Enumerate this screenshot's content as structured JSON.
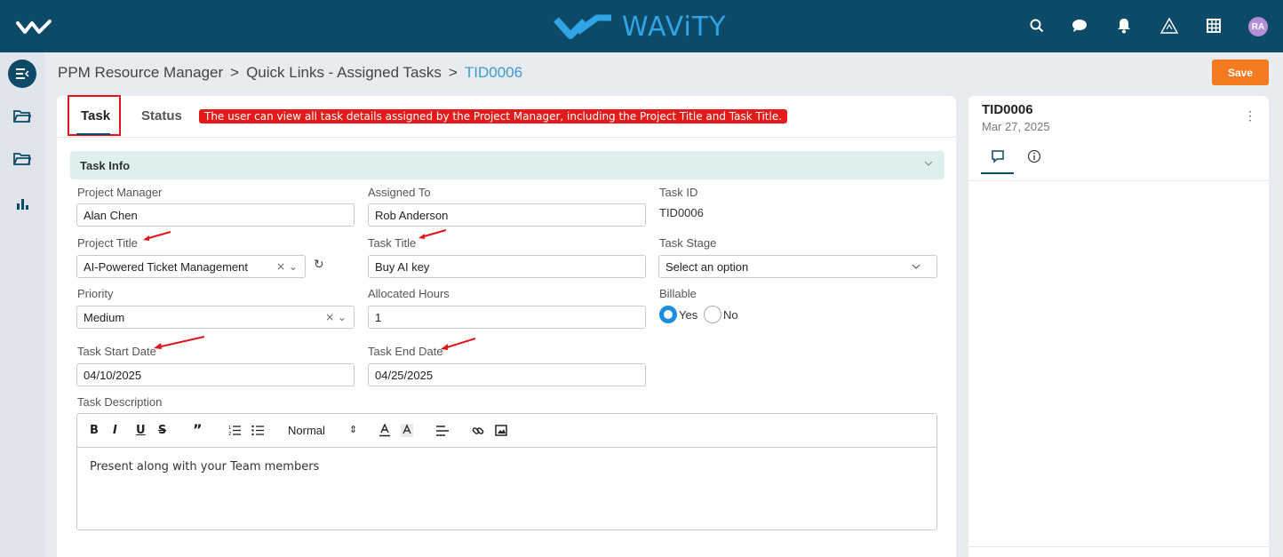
{
  "header": {
    "brand": "WAViTY",
    "avatar_initials": "RA",
    "icons": [
      "search-icon",
      "chat-icon",
      "bell-icon",
      "triangle-logo-icon",
      "grid-icon"
    ]
  },
  "sidebar": {
    "items": [
      "collapse-menu-icon",
      "folder-icon",
      "folder-icon",
      "bar-chart-icon"
    ]
  },
  "breadcrumb": {
    "item1": "PPM Resource Manager",
    "sep": ">",
    "item2": "Quick Links - Assigned Tasks",
    "current": "TID0006"
  },
  "toolbar": {
    "save_label": "Save"
  },
  "tabs": {
    "task": "Task",
    "status": "Status"
  },
  "annotation": "The user can view all task details assigned by the Project Manager, including the Project Title and Task Title.",
  "section": {
    "title": "Task Info"
  },
  "form": {
    "project_manager_label": "Project Manager",
    "project_manager_value": "Alan Chen",
    "assigned_to_label": "Assigned To",
    "assigned_to_value": "Rob Anderson",
    "task_id_label": "Task ID",
    "task_id_value": "TID0006",
    "project_title_label": "Project Title",
    "project_title_value": "AI-Powered Ticket Management",
    "task_title_label": "Task Title",
    "task_title_value": "Buy AI key",
    "task_stage_label": "Task Stage",
    "task_stage_placeholder": "Select an option",
    "priority_label": "Priority",
    "priority_value": "Medium",
    "allocated_hours_label": "Allocated Hours",
    "allocated_hours_value": "1",
    "billable_label": "Billable",
    "billable_yes": "Yes",
    "billable_no": "No",
    "billable_selected": "Yes",
    "task_start_label": "Task Start Date",
    "task_start_value": "04/10/2025",
    "task_end_label": "Task End Date",
    "task_end_value": "04/25/2025",
    "task_description_label": "Task Description",
    "task_description_value": "Present along with your Team members"
  },
  "editor": {
    "bold": "B",
    "italic": "I",
    "underline": "U",
    "strike": "S",
    "quote": "”",
    "heading_select": "Normal"
  },
  "side": {
    "title": "TID0006",
    "date": "Mar 27, 2025"
  },
  "colors": {
    "header_bg": "#0c4a67",
    "brand": "#2fa4e7",
    "save": "#f47a20",
    "annotation": "#e51b1b",
    "section_bg": "#ddf0ee",
    "breadcrumb_active": "#3a9bd5"
  }
}
